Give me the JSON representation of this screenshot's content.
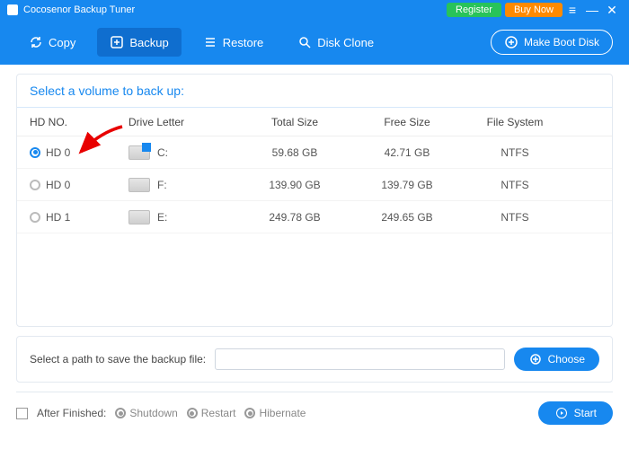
{
  "header": {
    "title": "Cocosenor Backup Tuner",
    "register": "Register",
    "buy": "Buy Now"
  },
  "toolbar": {
    "copy": "Copy",
    "backup": "Backup",
    "restore": "Restore",
    "diskclone": "Disk Clone",
    "bootdisk": "Make Boot Disk"
  },
  "panel": {
    "title": "Select a volume to back up:",
    "columns": {
      "c1": "HD NO.",
      "c2": "Drive Letter",
      "c3": "Total Size",
      "c4": "Free Size",
      "c5": "File System"
    },
    "rows": [
      {
        "hd": "HD 0",
        "letter": "C:",
        "total": "59.68 GB",
        "free": "42.71 GB",
        "fs": "NTFS",
        "selected": true,
        "win": true
      },
      {
        "hd": "HD 0",
        "letter": "F:",
        "total": "139.90 GB",
        "free": "139.79 GB",
        "fs": "NTFS",
        "selected": false,
        "win": false
      },
      {
        "hd": "HD 1",
        "letter": "E:",
        "total": "249.78 GB",
        "free": "249.65 GB",
        "fs": "NTFS",
        "selected": false,
        "win": false
      }
    ]
  },
  "path": {
    "label": "Select a path to save the backup file:",
    "value": "",
    "choose": "Choose"
  },
  "footer": {
    "after": "After Finished:",
    "shutdown": "Shutdown",
    "restart": "Restart",
    "hibernate": "Hibernate",
    "start": "Start"
  }
}
